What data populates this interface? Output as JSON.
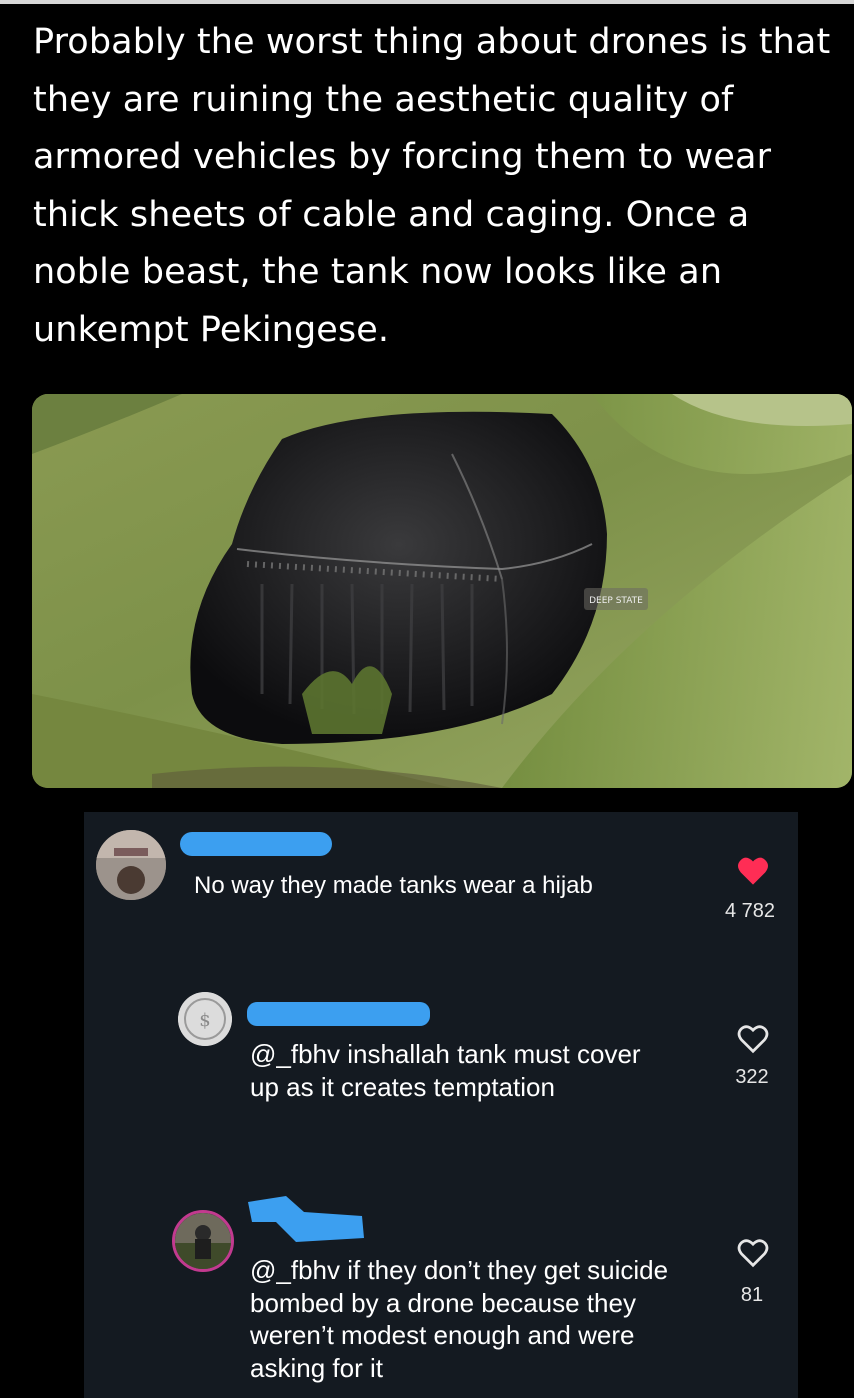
{
  "post": {
    "text": "Probably the worst thing about drones is that they are ruining the aesthetic quality of armored vehicles by forcing them to wear thick sheets of cable and caging. Once a noble beast, the tank now looks like an unkempt Pekingese."
  },
  "photo": {
    "watermark": "DEEP STATE"
  },
  "comments": [
    {
      "text": "No way they made tanks wear a hijab",
      "likes": "4 782",
      "liked": true
    },
    {
      "mention": "@_fbhv",
      "text": " inshallah tank must cover up as it creates temptation",
      "likes": "322",
      "liked": false
    },
    {
      "mention": "@_fbhv",
      "text": " if they don’t they get suicide bombed by a drone because they weren’t modest enough and were asking for it",
      "likes": "81",
      "liked": false
    }
  ],
  "colors": {
    "comment_bg": "#141a21",
    "heart_liked": "#ff2d55",
    "redaction": "#3c9ff0"
  }
}
